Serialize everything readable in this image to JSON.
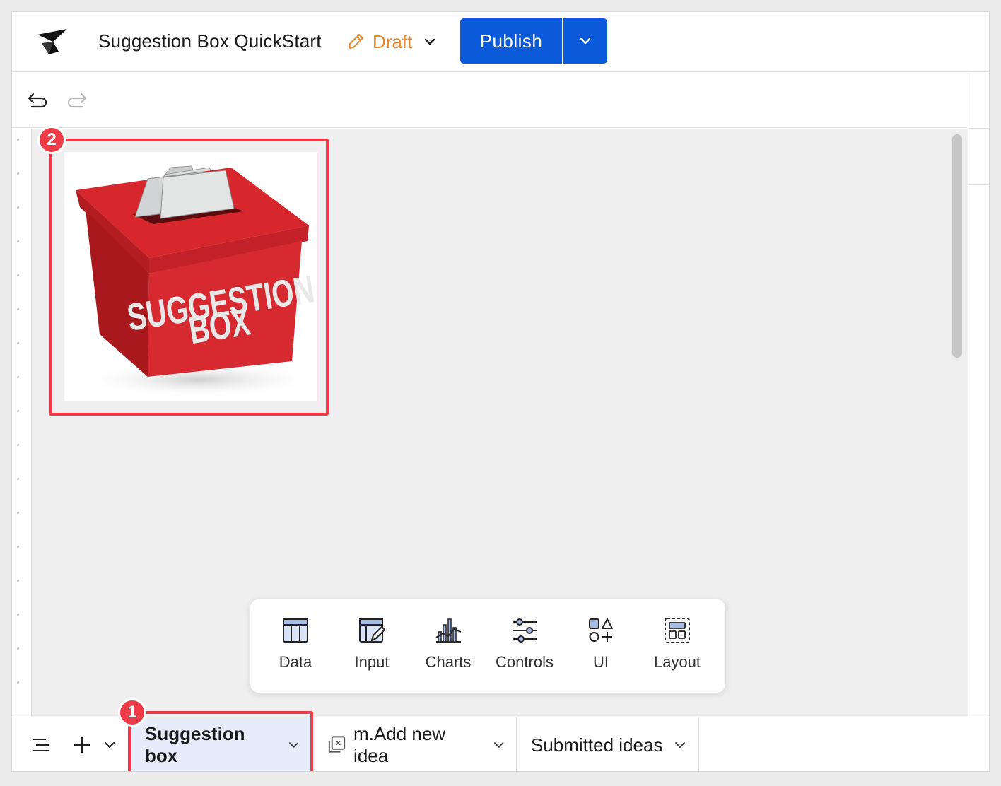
{
  "header": {
    "doc_title": "Suggestion Box QuickStart",
    "status": "Draft",
    "publish_label": "Publish"
  },
  "canvas": {
    "image_alt_text": "SUGGESTION BOX",
    "image_alt_line1": "SUGGESTION",
    "image_alt_line2": "BOX"
  },
  "annotations": {
    "badge_1": "1",
    "badge_2": "2",
    "highlight_color": "#ef3b48"
  },
  "element_panel": {
    "items": [
      {
        "label": "Data",
        "icon": "table-icon"
      },
      {
        "label": "Input",
        "icon": "input-table-icon"
      },
      {
        "label": "Charts",
        "icon": "chart-icon"
      },
      {
        "label": "Controls",
        "icon": "sliders-icon"
      },
      {
        "label": "UI",
        "icon": "shapes-icon"
      },
      {
        "label": "Layout",
        "icon": "layout-icon"
      }
    ]
  },
  "tabs": [
    {
      "label": "Suggestion box",
      "active": true
    },
    {
      "label": "m.Add new idea",
      "modal": true
    },
    {
      "label": "Submitted ideas"
    }
  ],
  "colors": {
    "primary": "#0b5ad9",
    "draft": "#e8892b",
    "active_tab_bg": "#e7ecfa"
  }
}
